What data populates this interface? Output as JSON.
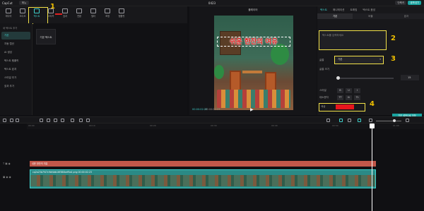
{
  "app": {
    "name": "CapCut",
    "menu_label": "메뉴",
    "project_title": "0423"
  },
  "titlebar": {
    "buttons": [
      "단축키",
      "내보내기"
    ]
  },
  "toolbar": {
    "tools": [
      {
        "label": "미디어"
      },
      {
        "label": "오디오"
      },
      {
        "label": "텍스트",
        "active": true
      },
      {
        "label": "스티커"
      },
      {
        "label": "효과"
      },
      {
        "label": "전환"
      },
      {
        "label": "필터"
      },
      {
        "label": "조정"
      },
      {
        "label": "템플릿"
      }
    ]
  },
  "sidebar": {
    "header": "새 텍스트 추가",
    "items": [
      "기본",
      "자동 캡션",
      "AI 생성",
      "텍스트 템플릿",
      "텍스트 효과",
      "스타일 추가",
      "효과 추가"
    ]
  },
  "media": {
    "card_label": "기본 텍스트"
  },
  "player": {
    "title": "플레이어",
    "caption": "쉬운 한잔의 여유",
    "timecode_current": "00:00:02:23",
    "timecode_total": "00:00:02:23"
  },
  "properties": {
    "tabs": [
      "텍스트",
      "애니메이션",
      "트래킹",
      "텍스트 음성"
    ],
    "subtabs": [
      "기본",
      "버블",
      "효과"
    ],
    "textarea_placeholder": "텍스트를 입력하세요",
    "font_label": "글꼴",
    "font_value": "기본",
    "size_label": "글꼴 크기",
    "size_value": "15",
    "pattern_label": "스타일",
    "case_label": "대소문자",
    "pattern_buttons": [
      "B",
      "U",
      "I"
    ],
    "case_buttons": [
      "TT",
      "tt",
      "Tt"
    ],
    "color_label": "색상",
    "color_hex": "#e8161c",
    "save_label": "기본 설정으로 저장"
  },
  "annotations": [
    "1",
    "2",
    "3",
    "4"
  ],
  "timeline": {
    "ruler_ticks": [
      "00:00",
      "00:10",
      "00:20",
      "00:30",
      "00:40",
      "00:50",
      "01:00",
      "01:10"
    ],
    "text_clip_label": "쉬운 한잔의 여유",
    "video_clip_label": "cq2a23b7f47c9bf4db16f380bef9a4 png 00:00:02:23"
  }
}
